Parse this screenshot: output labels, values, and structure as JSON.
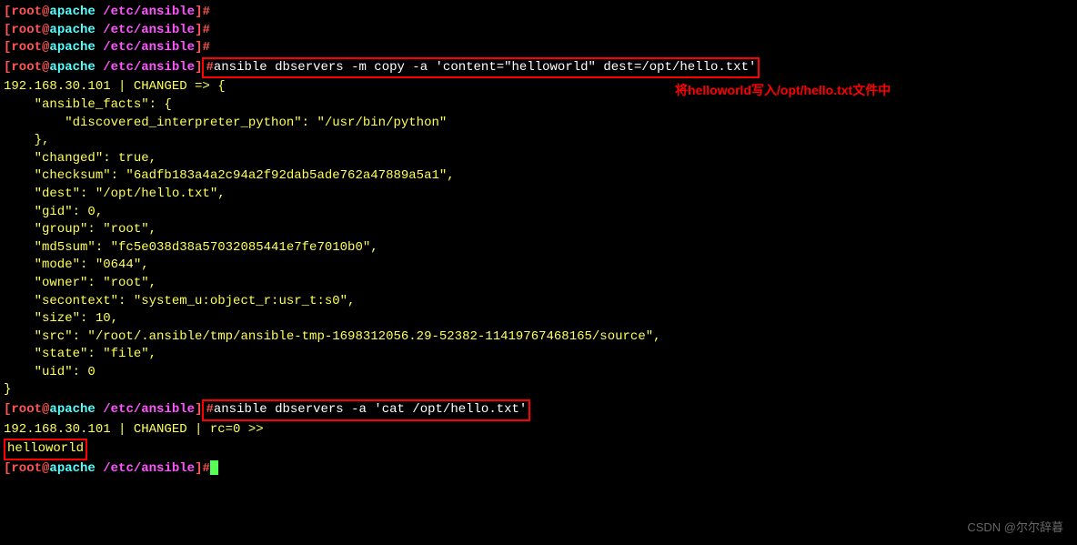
{
  "prompt": {
    "bracket_open": "[",
    "user": "root",
    "at": "@",
    "host": "apache",
    "path": " /etc/ansible",
    "bracket_close": "]",
    "hash": "#"
  },
  "commands": {
    "cmd1": "ansible dbservers -m copy -a 'content=\"helloworld\" dest=/opt/hello.txt'",
    "cmd2": "ansible dbservers -a 'cat /opt/hello.txt'"
  },
  "output": {
    "header1": "192.168.30.101 | CHANGED => {",
    "lines": [
      "    \"ansible_facts\": {",
      "        \"discovered_interpreter_python\": \"/usr/bin/python\"",
      "    },",
      "    \"changed\": true,",
      "    \"checksum\": \"6adfb183a4a2c94a2f92dab5ade762a47889a5a1\",",
      "    \"dest\": \"/opt/hello.txt\",",
      "    \"gid\": 0,",
      "    \"group\": \"root\",",
      "    \"md5sum\": \"fc5e038d38a57032085441e7fe7010b0\",",
      "    \"mode\": \"0644\",",
      "    \"owner\": \"root\",",
      "    \"secontext\": \"system_u:object_r:usr_t:s0\",",
      "    \"size\": 10,",
      "    \"src\": \"/root/.ansible/tmp/ansible-tmp-1698312056.29-52382-11419767468165/source\",",
      "    \"state\": \"file\",",
      "    \"uid\": 0"
    ],
    "close": "}",
    "header2": "192.168.30.101 | CHANGED | rc=0 >>",
    "result": "helloworld"
  },
  "annotation": {
    "text": "将helloworld写入/opt/hello.txt文件中"
  },
  "watermark": "CSDN @尔尔辞暮"
}
